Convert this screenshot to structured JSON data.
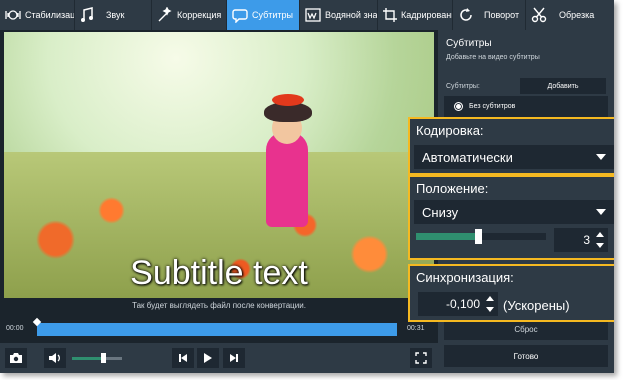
{
  "toolbar": {
    "items": [
      {
        "label": "Стабилизация",
        "icon": "stabilize-icon"
      },
      {
        "label": "Звук",
        "icon": "music-note-icon"
      },
      {
        "label": "Коррекция",
        "icon": "correction-icon"
      },
      {
        "label": "Субтитры",
        "icon": "speech-bubble-icon",
        "active": true
      },
      {
        "label": "Водяной знак",
        "icon": "watermark-icon"
      },
      {
        "label": "Кадрирование",
        "icon": "crop-icon"
      },
      {
        "label": "Поворот",
        "icon": "rotate-icon"
      },
      {
        "label": "Обрезка",
        "icon": "scissors-icon"
      }
    ]
  },
  "preview": {
    "subtitle_text": "Subtitle text",
    "caption": "Так будет выглядеть файл после конвертации."
  },
  "timeline": {
    "start": "00:00",
    "end": "00:31",
    "position_fraction": 0.0
  },
  "controls": {
    "volume_fraction": 0.62
  },
  "panel": {
    "title": "Субтитры",
    "description": "Добавьте на видео субтитры",
    "subs_label": "Субтитры:",
    "add_button": "Добавить",
    "no_subs_option": "Без субтитров",
    "reset_button": "Сброс",
    "done_button": "Готово"
  },
  "encoding": {
    "label": "Кодировка:",
    "value": "Автоматически"
  },
  "position": {
    "label": "Положение:",
    "value": "Снизу",
    "slider_fraction": 0.48,
    "offset_value": "3"
  },
  "sync": {
    "label": "Синхронизация:",
    "value": "-0,100",
    "note": "(Ускорены)"
  },
  "colors": {
    "accent": "#3d9be9",
    "callout": "#f5b921",
    "slider_fill": "#2f8f6f",
    "background": "#1e2832"
  }
}
